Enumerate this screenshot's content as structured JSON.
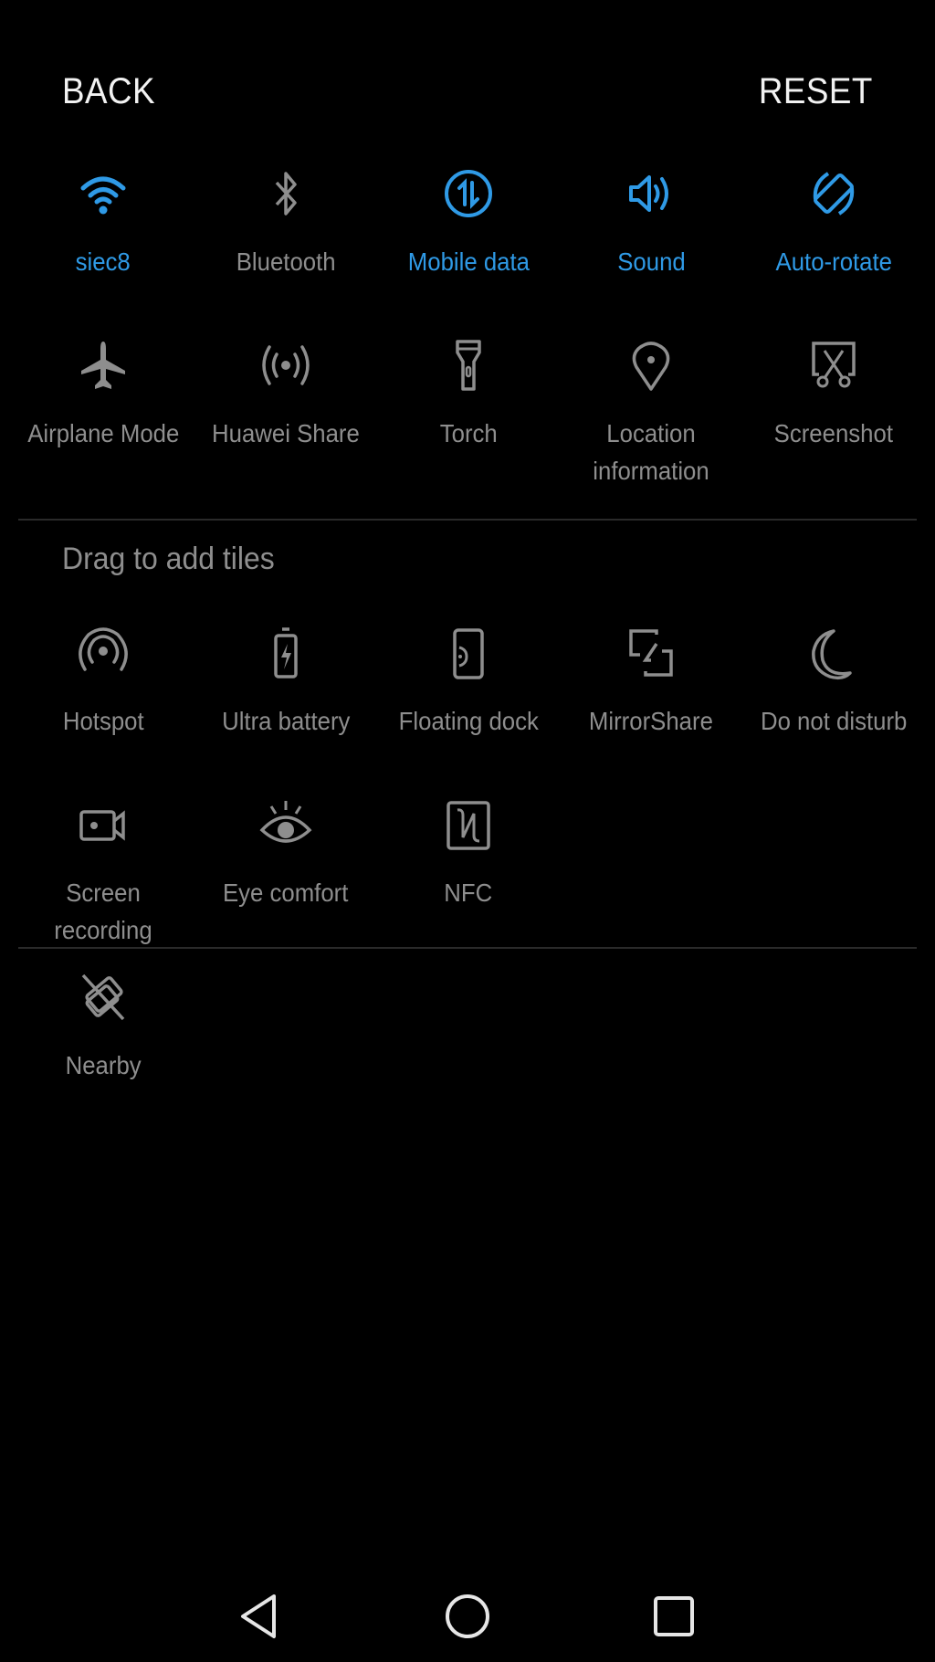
{
  "header": {
    "back_label": "BACK",
    "reset_label": "RESET"
  },
  "colors": {
    "accent": "#2f9ae6",
    "inactive": "#8e8e8e",
    "background": "#000000",
    "text_white": "#f2f2f2"
  },
  "active_tiles": [
    {
      "label": "siec8",
      "icon": "wifi-icon",
      "on": true
    },
    {
      "label": "Bluetooth",
      "icon": "bluetooth-icon",
      "on": false
    },
    {
      "label": "Mobile data",
      "icon": "mobile-data-icon",
      "on": true
    },
    {
      "label": "Sound",
      "icon": "sound-icon",
      "on": true
    },
    {
      "label": "Auto-rotate",
      "icon": "auto-rotate-icon",
      "on": true
    },
    {
      "label": "Airplane Mode",
      "icon": "airplane-icon",
      "on": false
    },
    {
      "label": "Huawei Share",
      "icon": "huawei-share-icon",
      "on": false
    },
    {
      "label": "Torch",
      "icon": "torch-icon",
      "on": false
    },
    {
      "label": "Location information",
      "icon": "location-icon",
      "on": false
    },
    {
      "label": "Screenshot",
      "icon": "screenshot-icon",
      "on": false
    }
  ],
  "add_section": {
    "title": "Drag to add tiles",
    "tiles": [
      {
        "label": "Hotspot",
        "icon": "hotspot-icon"
      },
      {
        "label": "Ultra battery",
        "icon": "ultra-battery-icon"
      },
      {
        "label": "Floating dock",
        "icon": "floating-dock-icon"
      },
      {
        "label": "MirrorShare",
        "icon": "mirrorshare-icon"
      },
      {
        "label": "Do not disturb",
        "icon": "moon-icon"
      },
      {
        "label": "Screen recording",
        "icon": "screen-recording-icon"
      },
      {
        "label": "Eye comfort",
        "icon": "eye-comfort-icon"
      },
      {
        "label": "NFC",
        "icon": "nfc-icon"
      }
    ]
  },
  "extra_tiles": [
    {
      "label": "Nearby",
      "icon": "nearby-icon"
    }
  ],
  "navbar": {
    "back": "back-triangle-icon",
    "home": "home-circle-icon",
    "recents": "recents-square-icon"
  }
}
